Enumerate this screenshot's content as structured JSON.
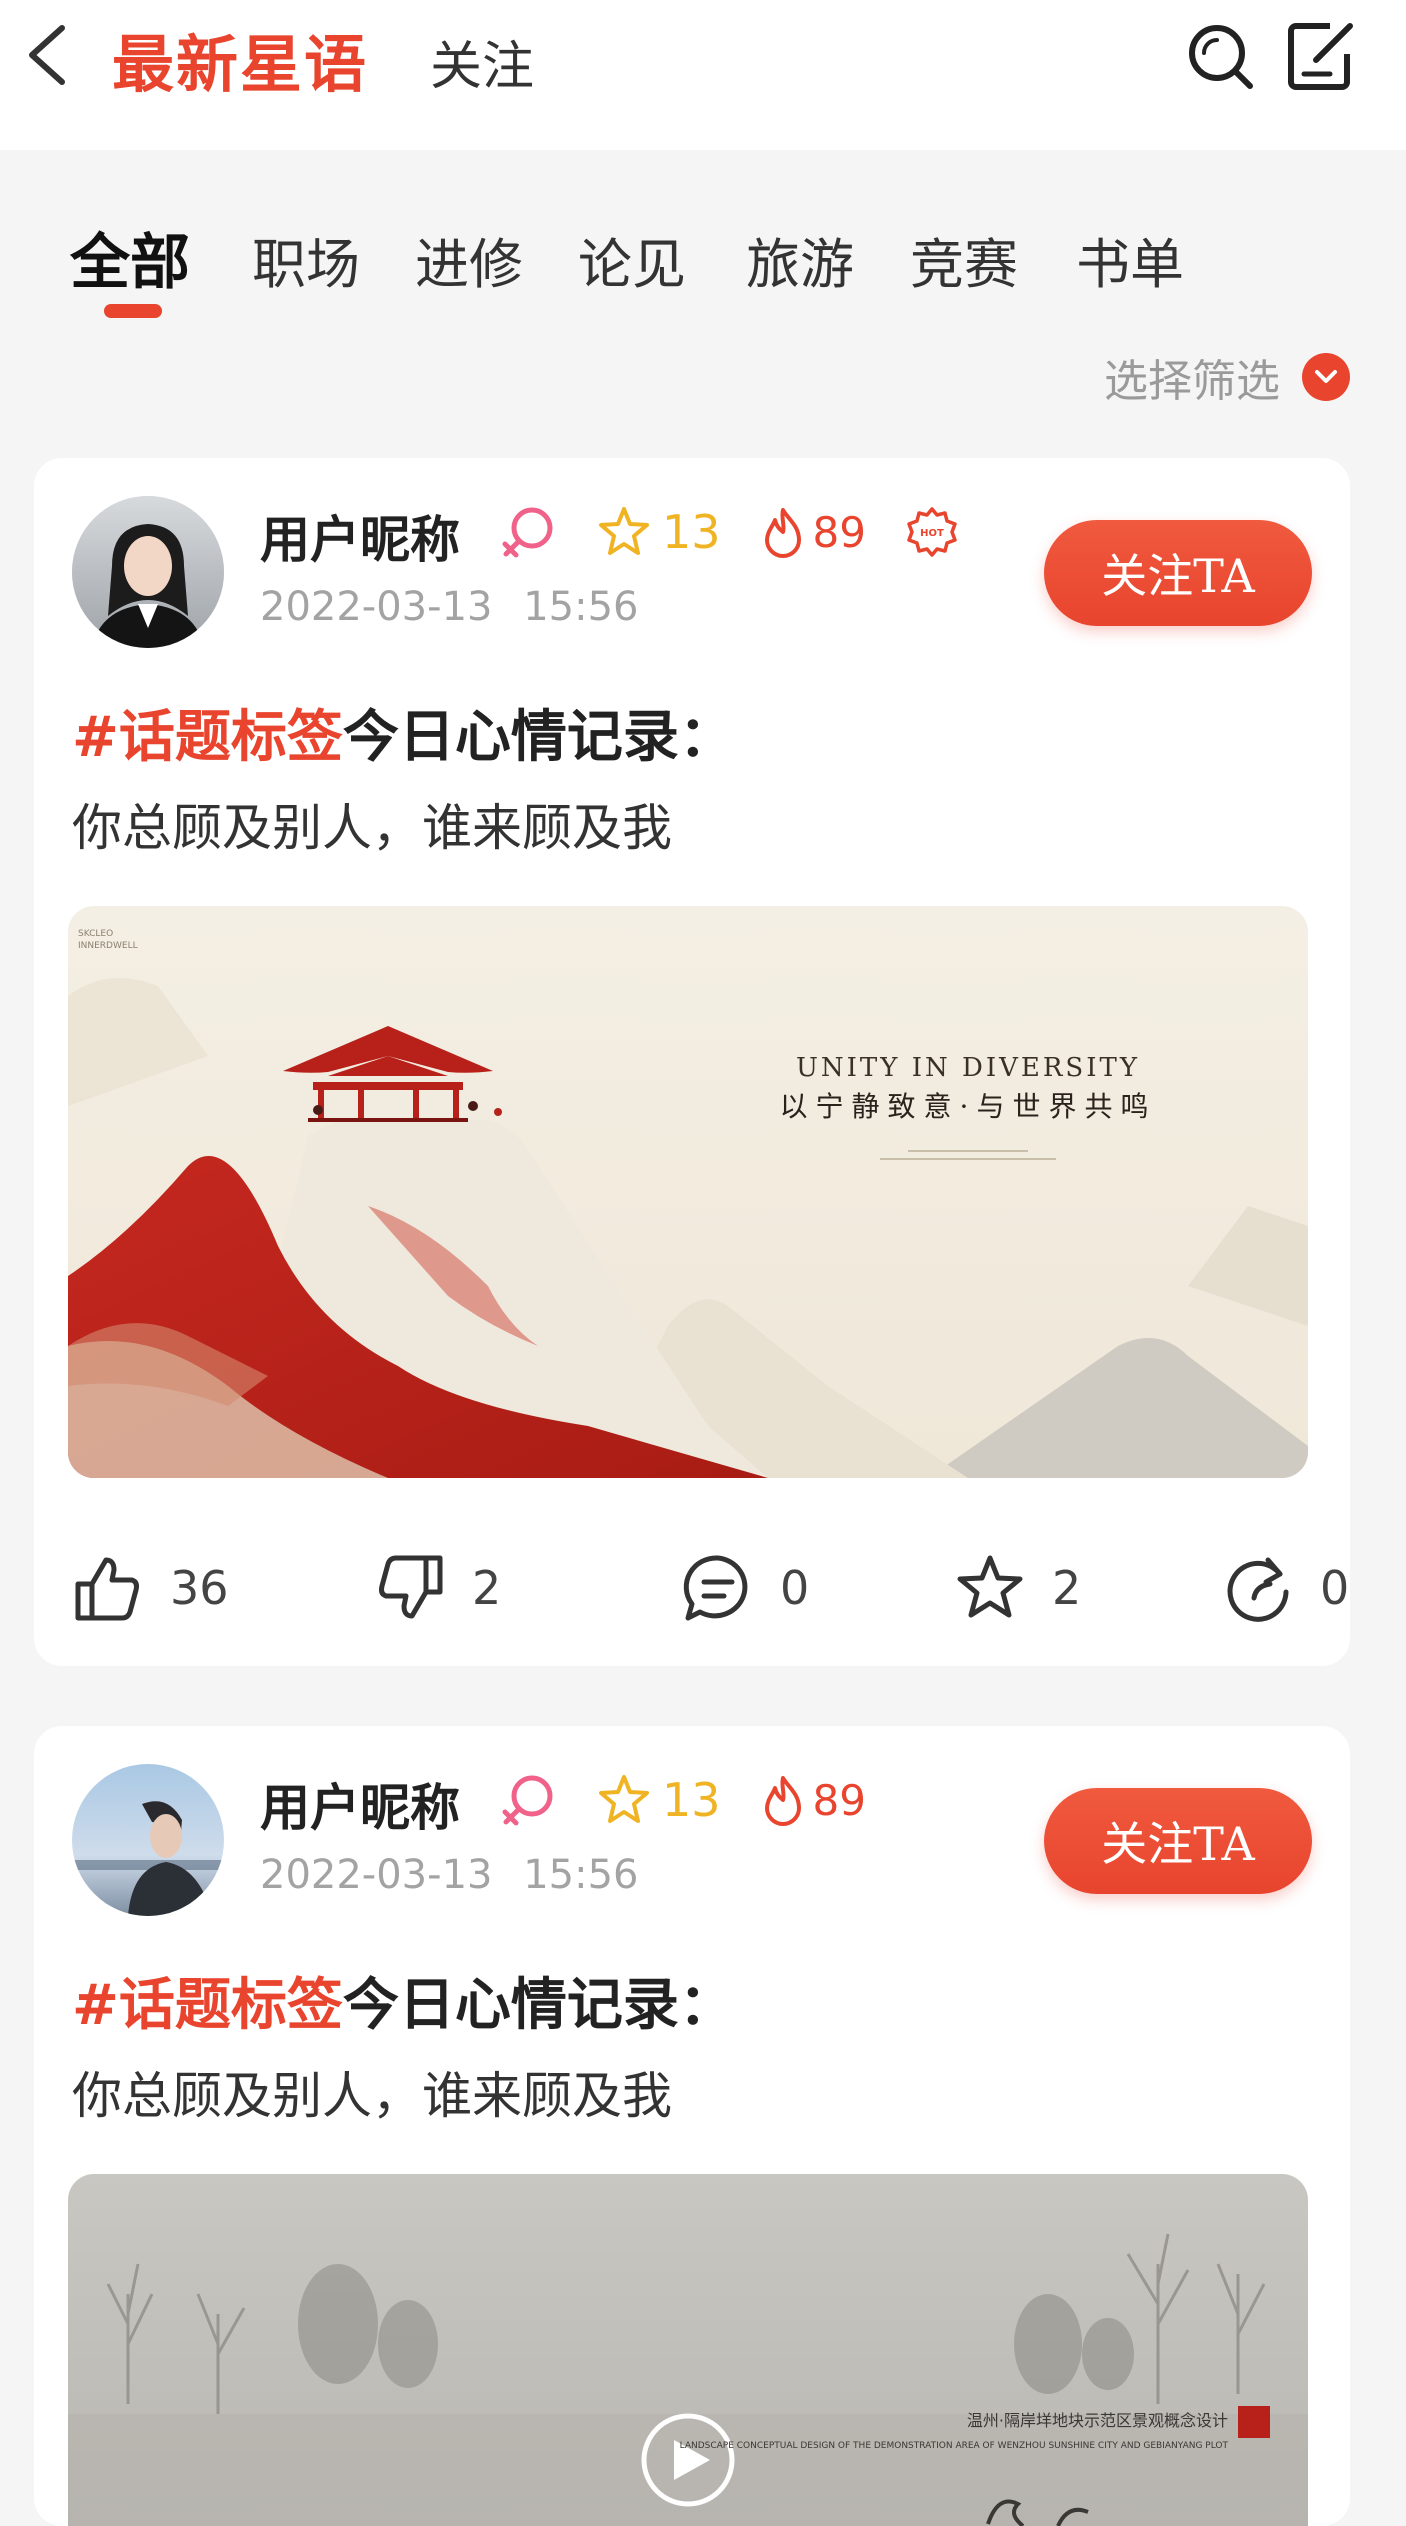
{
  "header": {
    "title": "最新星语",
    "follow_tab": "关注"
  },
  "tabs": [
    "全部",
    "职场",
    "进修",
    "论见",
    "旅游",
    "竞赛",
    "书单"
  ],
  "filter": {
    "label": "选择筛选"
  },
  "posts": [
    {
      "user_name": "用户昵称",
      "stars": "13",
      "fire": "89",
      "has_hot_badge": true,
      "date": "2022-03-13",
      "time": "15:56",
      "follow_label": "关注TA",
      "hashtag": "#话题标签",
      "title": "今日心情记录：",
      "body": "你总顾及别人，谁来顾及我",
      "image": {
        "caption_en": "UNITY IN DIVERSITY",
        "caption_cn": "以宁静致意·与世界共鸣"
      },
      "likes": "36",
      "dislikes": "2",
      "comments": "0",
      "favorites": "2",
      "shares": "0"
    },
    {
      "user_name": "用户昵称",
      "stars": "13",
      "fire": "89",
      "has_hot_badge": false,
      "date": "2022-03-13",
      "time": "15:56",
      "follow_label": "关注TA",
      "hashtag": "#话题标签",
      "title": "今日心情记录：",
      "body": "你总顾及别人，谁来顾及我",
      "image": {
        "caption_top": "温州·隔岸垟地块示范区景观概念设计",
        "caption_en": "LANDSCAPE CONCEPTUAL DESIGN OF THE DEMONSTRATION AREA OF WENZHOU SUNSHINE CITY AND GEBIANYANG PLOT"
      }
    }
  ],
  "colors": {
    "accent": "#e8442e",
    "star": "#f0b323",
    "background": "#f5f5f5"
  }
}
